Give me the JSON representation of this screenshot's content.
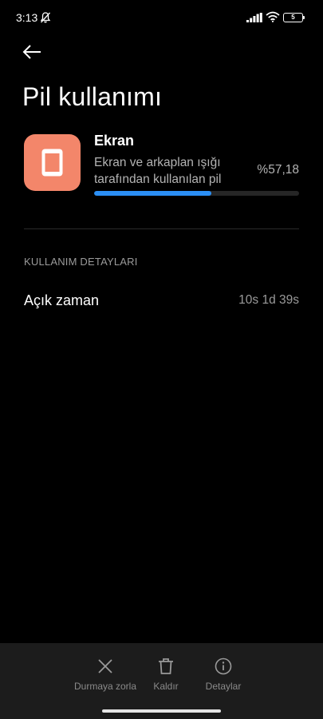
{
  "status_bar": {
    "time": "3:13",
    "battery_level": "5",
    "icons": [
      "bell-muted-icon",
      "signal-icon",
      "wifi-icon",
      "battery-icon"
    ]
  },
  "header": {
    "back_icon": "arrow-left-icon",
    "title": "Pil kullanımı"
  },
  "app": {
    "name": "Ekran",
    "icon": "tablet-icon",
    "icon_color": "#f3866a",
    "description": "Ekran ve arkaplan ışığı tarafından kullanılan pil",
    "percent_text": "%57,18",
    "usage_fraction": 0.5718,
    "bar_color": "#2b8ff5"
  },
  "details": {
    "section_title": "KULLANIM DETAYLARI",
    "rows": [
      {
        "label": "Açık zaman",
        "value": "10s 1d 39s"
      }
    ]
  },
  "bottom_actions": [
    {
      "label": "Durmaya zorla",
      "icon": "close-icon"
    },
    {
      "label": "Kaldır",
      "icon": "trash-icon"
    },
    {
      "label": "Detaylar",
      "icon": "info-icon"
    }
  ]
}
